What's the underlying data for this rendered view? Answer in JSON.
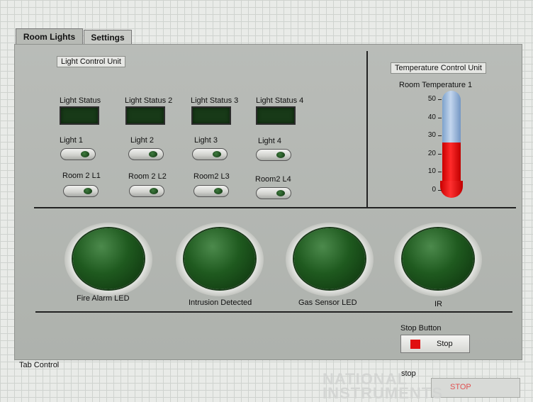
{
  "tabs": [
    {
      "label": "Room Lights",
      "active": true
    },
    {
      "label": "Settings",
      "active": false
    }
  ],
  "light_control": {
    "title": "Light Control Unit",
    "status_labels": [
      "Light Status",
      "Light Status 2",
      "Light Status 3",
      "Light Status 4"
    ],
    "light_labels": [
      "Light 1",
      "Light 2",
      "Light 3",
      "Light 4"
    ],
    "room2_labels": [
      "Room 2 L1",
      "Room 2 L2",
      "Room2 L3",
      "Room2 L4"
    ]
  },
  "temperature_control": {
    "title": "Temperature Control Unit",
    "gauge_label": "Room Temperature 1",
    "scale": [
      50,
      40,
      30,
      20,
      10,
      0
    ],
    "value": 26
  },
  "leds": [
    {
      "label": "Fire Alarm LED"
    },
    {
      "label": "Intrusion Detected"
    },
    {
      "label": "Gas Sensor LED"
    },
    {
      "label": "IR"
    }
  ],
  "stop_button": {
    "caption": "Stop Button",
    "label": "Stop"
  },
  "tab_control_label": "Tab Control",
  "stop_control": {
    "caption": "stop",
    "label": "STOP"
  },
  "watermark": {
    "line1": "NATIONAL",
    "line2": "INSTRUMENTS"
  },
  "colors": {
    "led_off": "#1f5a1f",
    "stop_red": "#e01010",
    "thermo_red": "#e00000",
    "thermo_blue": "#9dbde3"
  }
}
